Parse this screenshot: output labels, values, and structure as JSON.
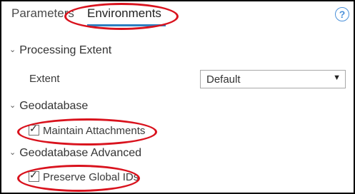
{
  "tabs": {
    "parameters_label": "Parameters",
    "environments_label": "Environments"
  },
  "help": {
    "icon_glyph": "?"
  },
  "processing_extent": {
    "header": "Processing Extent",
    "extent_label": "Extent",
    "extent_value": "Default"
  },
  "geodatabase": {
    "header": "Geodatabase",
    "maintain_attachments_label": "Maintain Attachments",
    "maintain_attachments_checked": true
  },
  "geodatabase_advanced": {
    "header": "Geodatabase Advanced",
    "preserve_global_ids_label": "Preserve Global IDs",
    "preserve_global_ids_checked": true
  },
  "glyphs": {
    "chevron": "⌄",
    "caret": "▼",
    "check": "✓"
  },
  "colors": {
    "accent": "#2d7fc1",
    "annotation_red": "#d9121d"
  }
}
